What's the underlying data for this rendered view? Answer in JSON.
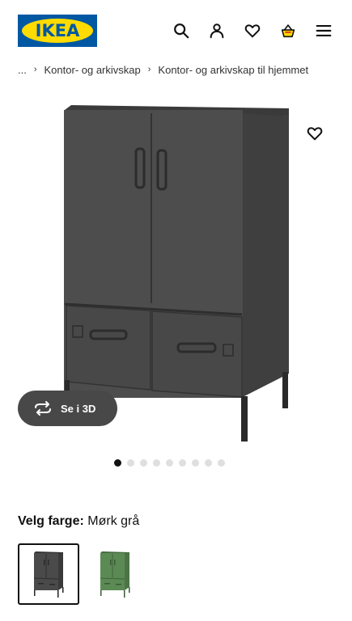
{
  "header": {
    "logo_text": "IKEA",
    "icons": [
      "search-icon",
      "user-icon",
      "heart-icon",
      "basket-icon",
      "menu-icon"
    ],
    "colors": {
      "logo_blue": "#0058a3",
      "logo_yellow": "#ffdb00",
      "basket_yellow": "#ffdb00",
      "basket_accent": "#e2231a"
    }
  },
  "breadcrumb": {
    "ellipsis": "...",
    "items": [
      "Kontor- og arkivskap",
      "Kontor- og arkivskap til hjemmet"
    ]
  },
  "product": {
    "view_3d_label": "Se i 3D",
    "gallery": {
      "count": 9,
      "active_index": 0
    },
    "product_color": "#4a4a4a"
  },
  "color_select": {
    "label": "Velg farge:",
    "selected": "Mørk grå",
    "options": [
      {
        "name": "dark-grey",
        "hex": "#4a4a4a",
        "selected": true
      },
      {
        "name": "green",
        "hex": "#5b8a55",
        "selected": false
      }
    ]
  }
}
